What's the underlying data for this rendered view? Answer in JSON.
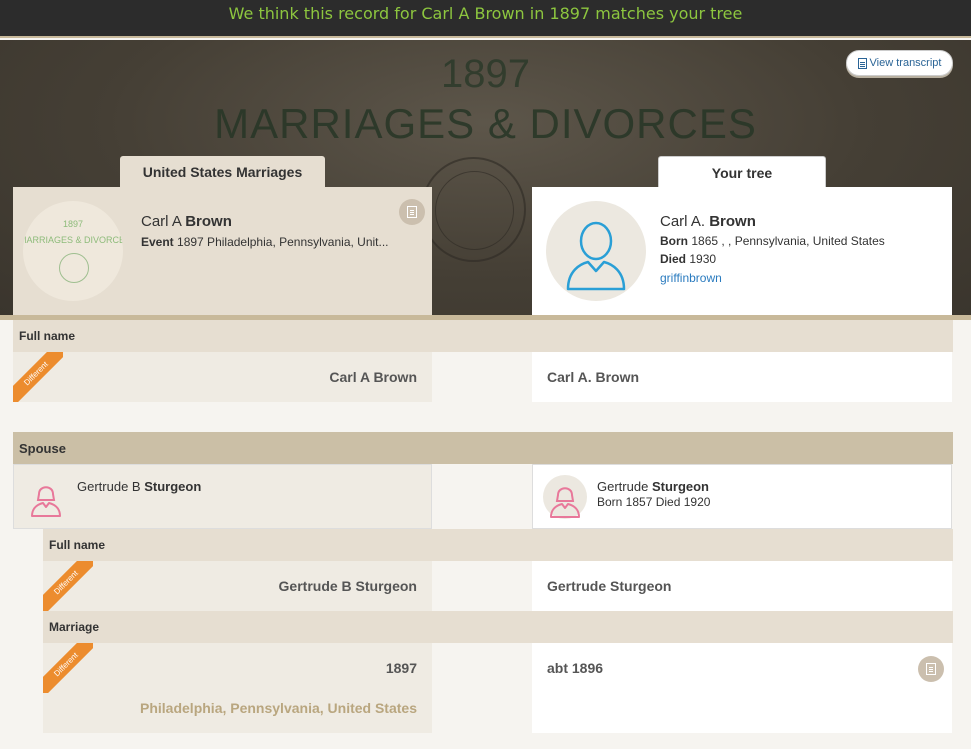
{
  "banner": {
    "message": "We think this record for Carl A Brown in 1897 matches your tree"
  },
  "hero": {
    "year": "1897",
    "title": "MARRIAGES & DIVORCES"
  },
  "toolbar": {
    "view_transcript": "View transcript"
  },
  "tabs": {
    "record": "United States Marriages",
    "tree": "Your tree"
  },
  "record": {
    "thumb_year": "1897",
    "thumb_title": "MARRIAGES & DIVORCES",
    "given": "Carl A",
    "surname": "Brown",
    "event_label": "Event",
    "event_value": "1897 Philadelphia, Pennsylvania, Unit..."
  },
  "tree": {
    "given": "Carl A.",
    "surname": "Brown",
    "born_label": "Born",
    "born_value": "1865 , , Pennsylvania, United States",
    "died_label": "Died",
    "died_value": "1930",
    "owner": "griffinbrown"
  },
  "full_name": {
    "label": "Full name",
    "badge": "Different",
    "record": "Carl A Brown",
    "tree": "Carl A. Brown"
  },
  "spouse": {
    "label": "Spouse",
    "record_given": "Gertrude B",
    "record_surname": "Sturgeon",
    "tree_given": "Gertrude",
    "tree_surname": "Sturgeon",
    "tree_sub": "Born 1857 Died 1920",
    "full_name_label": "Full name",
    "full_name_badge": "Different",
    "full_name_record": "Gertrude B Sturgeon",
    "full_name_tree": "Gertrude Sturgeon",
    "marriage_label": "Marriage",
    "marriage_badge": "Different",
    "marriage_record_year": "1897",
    "marriage_record_place": "Philadelphia, Pennsylvania, United States",
    "marriage_tree": "abt 1896"
  },
  "colors": {
    "banner_text": "#8dc63f",
    "badge": "#ec8c2e",
    "male_icon": "#2a9fd6",
    "female_icon": "#e8789a",
    "link": "#2a7bbf"
  }
}
